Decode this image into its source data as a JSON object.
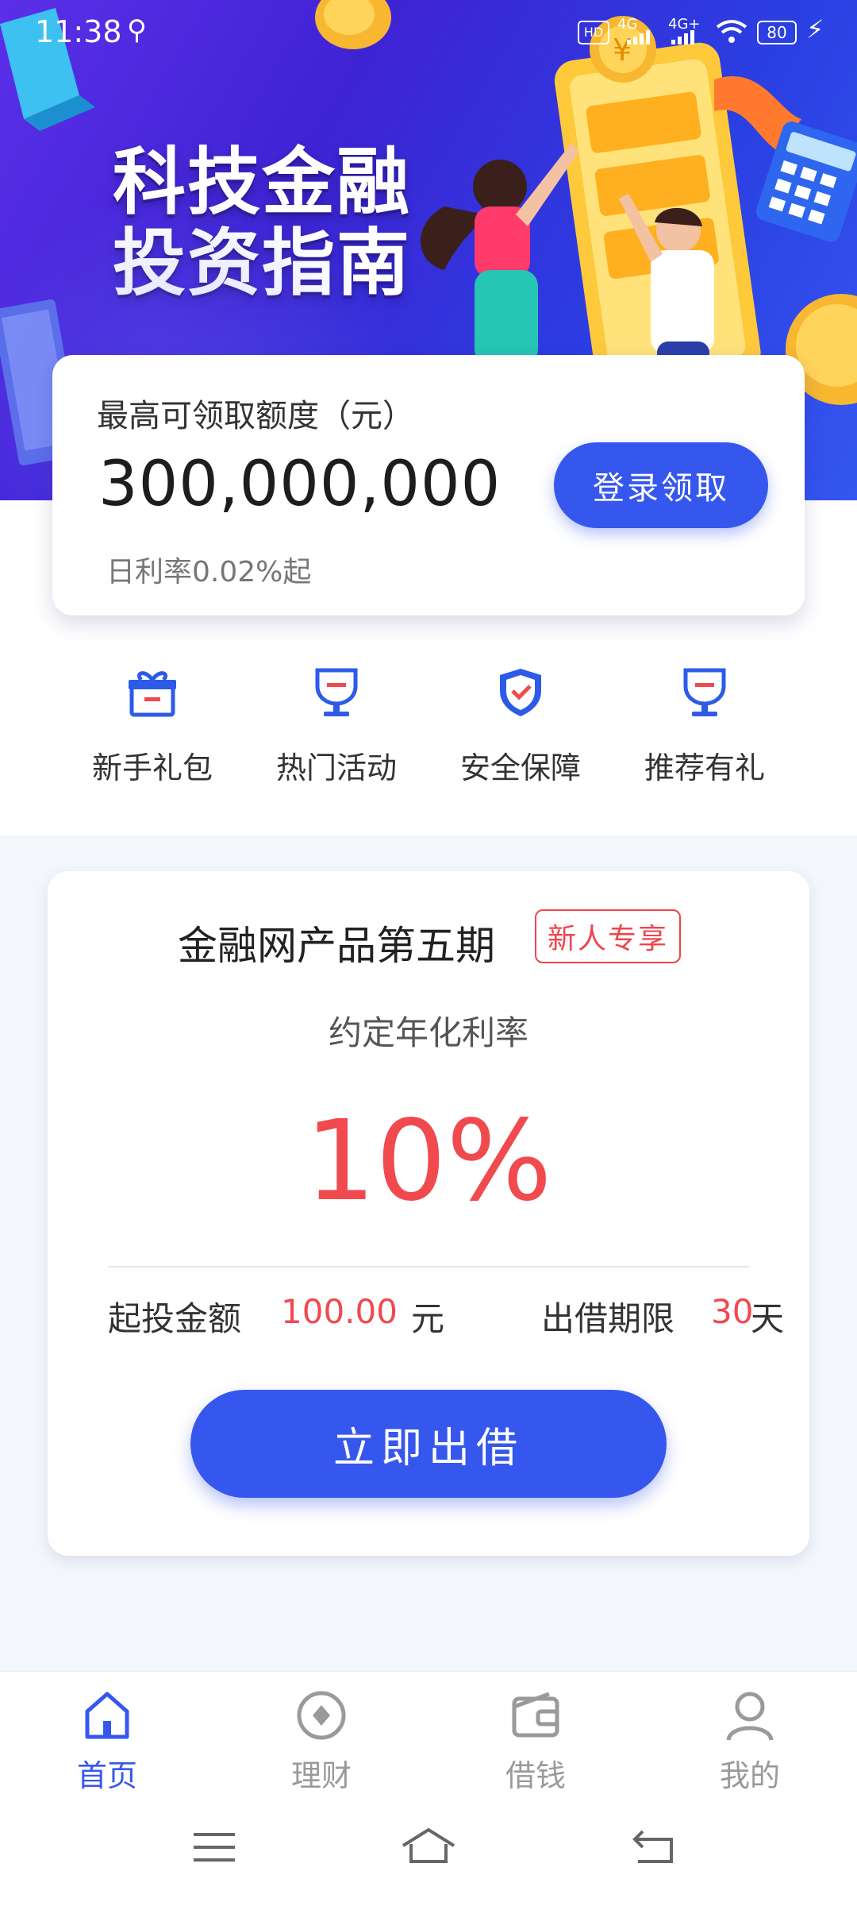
{
  "status_bar": {
    "time": "11:38",
    "battery": "80",
    "network_1": "4G",
    "network_2": "4G+"
  },
  "banner": {
    "line1": "科技金融",
    "line2": "投资指南"
  },
  "credit": {
    "title": "最高可领取额度（元）",
    "amount": "300,000,000",
    "rate_text": "日利率0.02%起",
    "button_label": "登录领取"
  },
  "quick_entries": [
    {
      "label": "新手礼包",
      "icon": "gift-icon"
    },
    {
      "label": "热门活动",
      "icon": "trophy-icon"
    },
    {
      "label": "安全保障",
      "icon": "shield-check-icon"
    },
    {
      "label": "推荐有礼",
      "icon": "trophy-icon"
    }
  ],
  "product": {
    "title": "金融网产品第五期",
    "badge": "新人专享",
    "rate_label": "约定年化利率",
    "rate_value": "10%",
    "min_invest_label": "起投金额",
    "min_invest_value": "100.00",
    "min_invest_unit": "元",
    "term_label": "出借期限",
    "term_value": "30",
    "term_unit": "天",
    "button_label": "立即出借"
  },
  "bottom_nav": {
    "items": [
      {
        "label": "首页",
        "icon": "home-icon",
        "active": true
      },
      {
        "label": "理财",
        "icon": "finance-icon",
        "active": false
      },
      {
        "label": "借钱",
        "icon": "wallet-icon",
        "active": false
      },
      {
        "label": "我的",
        "icon": "user-icon",
        "active": false
      }
    ]
  },
  "colors": {
    "accent": "#3657ee",
    "highlight": "#f04a4f",
    "banner": "#4a2be0"
  }
}
